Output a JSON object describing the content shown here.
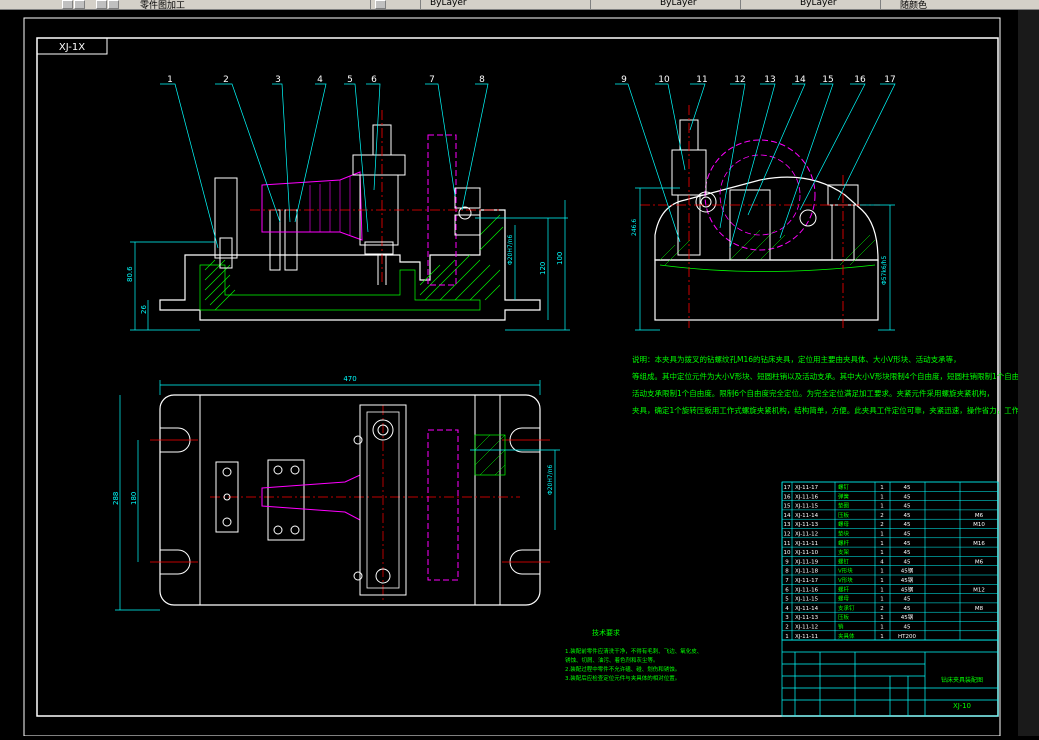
{
  "toolbar": {
    "file_label": "零件图加工",
    "layer_dropdown": "ByLayer",
    "linetype_dropdown": "ByLayer",
    "lineweight_dropdown": "ByLayer",
    "plot_style": "随颜色"
  },
  "drawing": {
    "tab_label": "XJ-1X",
    "part_numbers_front": [
      "1",
      "2",
      "3",
      "4",
      "5",
      "6",
      "7",
      "8"
    ],
    "part_numbers_side": [
      "9",
      "10",
      "11",
      "12",
      "13",
      "14",
      "15",
      "16",
      "17"
    ],
    "dim_front_height": "100",
    "dim_front_left1": "80.6",
    "dim_front_left2": "26",
    "dim_front_right1": "Φ20H7/n6",
    "dim_front_right2": "120",
    "dim_side_left": "246.6",
    "dim_side_right": "Φ57k6/h5",
    "dim_top_width": "470",
    "dim_top_left1": "288",
    "dim_top_left2": "180",
    "dim_top_right": "Φ20H7/n6",
    "notes_title": "技术要求",
    "notes_lines": [
      "1.装配前零件应清洗干净，不得有毛刺、飞边、氧化皮、",
      "  锈蚀、切屑、油污、着色剂和灰尘等。",
      "2.装配过程中零件不允许磕、碰、划伤和锈蚀。",
      "3.装配后应检查定位元件与夹具体的相对位置。"
    ],
    "description_lines": [
      "说明：本夹具为拨叉的钻螺纹孔M16的钻床夹具，定位用主要由夹具体、大小V形块、活动支承等，",
      "等组成。其中定位元件为大小V形块、短圆柱销以及活动支承。其中大小V形块限制4个自由度，短圆柱销限制1个自由度，",
      "活动支承限制1个自由度。限制6个自由度完全定位。为完全定位满足加工要求。夹紧元件采用螺旋夹紧机构，",
      "夹具，确定1个旋转压板用工作式螺旋夹紧机构，结构简单，方便。此夹具工件定位可靠，夹紧迅速，操作省力，工作效率高。"
    ],
    "bom_rows": [
      {
        "no": "17",
        "code": "XJ-11-17",
        "name": "螺钉",
        "qty": "1",
        "mat": "45",
        "note": ""
      },
      {
        "no": "16",
        "code": "XJ-11-16",
        "name": "弹簧",
        "qty": "1",
        "mat": "45",
        "note": ""
      },
      {
        "no": "15",
        "code": "XJ-11-15",
        "name": "垫圈",
        "qty": "1",
        "mat": "45",
        "note": ""
      },
      {
        "no": "14",
        "code": "XJ-11-14",
        "name": "压板",
        "qty": "2",
        "mat": "45",
        "note": "M6"
      },
      {
        "no": "13",
        "code": "XJ-11-13",
        "name": "螺母",
        "qty": "2",
        "mat": "45",
        "note": "M10"
      },
      {
        "no": "12",
        "code": "XJ-11-12",
        "name": "垫块",
        "qty": "1",
        "mat": "45",
        "note": ""
      },
      {
        "no": "11",
        "code": "XJ-11-11",
        "name": "螺杆",
        "qty": "1",
        "mat": "45",
        "note": "M16"
      },
      {
        "no": "10",
        "code": "XJ-11-10",
        "name": "支架",
        "qty": "1",
        "mat": "45",
        "note": ""
      },
      {
        "no": "9",
        "code": "XJ-11-19",
        "name": "螺钉",
        "qty": "4",
        "mat": "45",
        "note": "M6"
      },
      {
        "no": "8",
        "code": "XJ-11-18",
        "name": "V形块",
        "qty": "1",
        "mat": "45钢",
        "note": ""
      },
      {
        "no": "7",
        "code": "XJ-11-17",
        "name": "V形块",
        "qty": "1",
        "mat": "45钢",
        "note": ""
      },
      {
        "no": "6",
        "code": "XJ-11-16",
        "name": "螺杆",
        "qty": "1",
        "mat": "45钢",
        "note": "M12"
      },
      {
        "no": "5",
        "code": "XJ-11-15",
        "name": "螺母",
        "qty": "1",
        "mat": "45",
        "note": ""
      },
      {
        "no": "4",
        "code": "XJ-11-14",
        "name": "支承钉",
        "qty": "2",
        "mat": "45",
        "note": "M8"
      },
      {
        "no": "3",
        "code": "XJ-11-13",
        "name": "压板",
        "qty": "1",
        "mat": "45钢",
        "note": ""
      },
      {
        "no": "2",
        "code": "XJ-11-12",
        "name": "销",
        "qty": "1",
        "mat": "45",
        "note": ""
      },
      {
        "no": "1",
        "code": "XJ-11-11",
        "name": "夹具体",
        "qty": "1",
        "mat": "HT200",
        "note": ""
      }
    ],
    "title_block_name": "钻床夹具装配图",
    "title_block_code": "XJ-10"
  },
  "colors": {
    "background": "#000000",
    "frame": "#ffffff",
    "geometry": "#ffffff",
    "dimension": "#00ffff",
    "center_line": "#ff0000",
    "hidden": "#ff00ff",
    "hatch": "#00ff00",
    "text": "#00ff00",
    "table": "#00ffff"
  }
}
